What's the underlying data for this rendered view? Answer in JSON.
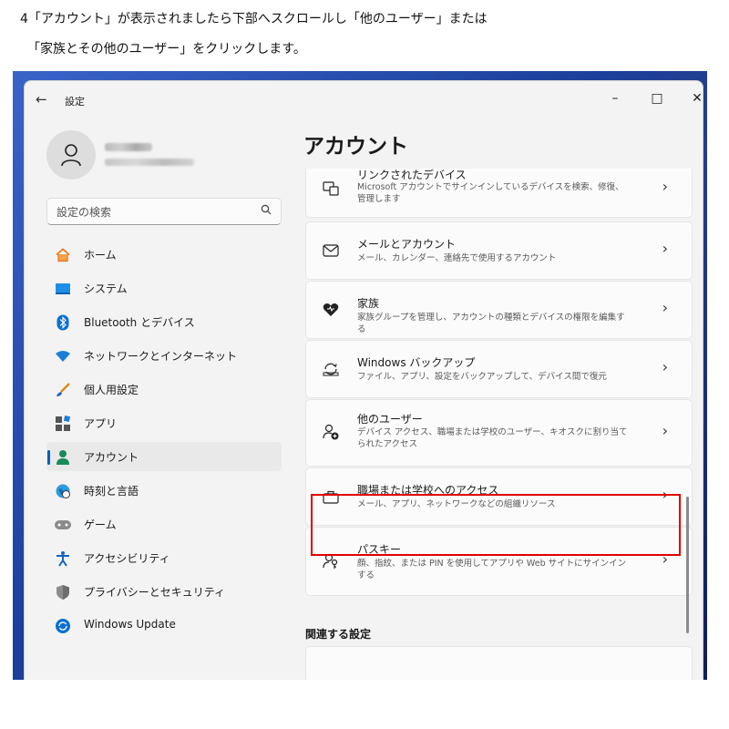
{
  "instructions": {
    "line1": "4「アカウント」が表示されましたら下部へスクロールし「他のユーザー」または",
    "line2": "「家族とその他のユーザー」をクリックします。"
  },
  "window": {
    "title": "設定",
    "back_icon": "arrow-left-icon",
    "controls": {
      "minimize": "–",
      "maximize": "□",
      "close": "✕"
    }
  },
  "search": {
    "placeholder": "設定の検索",
    "icon": "search-icon"
  },
  "sidebar": {
    "items": [
      {
        "label": "ホーム",
        "icon": "home-icon"
      },
      {
        "label": "システム",
        "icon": "monitor-icon"
      },
      {
        "label": "Bluetooth とデバイス",
        "icon": "bluetooth-icon"
      },
      {
        "label": "ネットワークとインターネット",
        "icon": "wifi-icon"
      },
      {
        "label": "個人用設定",
        "icon": "brush-icon"
      },
      {
        "label": "アプリ",
        "icon": "apps-icon"
      },
      {
        "label": "アカウント",
        "icon": "person-icon",
        "selected": true
      },
      {
        "label": "時刻と言語",
        "icon": "globe-clock-icon"
      },
      {
        "label": "ゲーム",
        "icon": "gamepad-icon"
      },
      {
        "label": "アクセシビリティ",
        "icon": "accessibility-icon"
      },
      {
        "label": "プライバシーとセキュリティ",
        "icon": "shield-icon"
      },
      {
        "label": "Windows Update",
        "icon": "update-icon"
      }
    ]
  },
  "main": {
    "title": "アカウント",
    "cards": [
      {
        "title": "リンクされたデバイス",
        "desc": "Microsoft アカウントでサインインしているデバイスを検索、修復、管理します",
        "icon": "linked-devices-icon"
      },
      {
        "title": "メールとアカウント",
        "desc": "メール、カレンダー、連絡先で使用するアカウント",
        "icon": "mail-icon"
      },
      {
        "title": "家族",
        "desc": "家族グループを管理し、アカウントの種類とデバイスの権限を編集する",
        "icon": "family-heart-icon"
      },
      {
        "title": "Windows バックアップ",
        "desc": "ファイル、アプリ、設定をバックアップして、デバイス間で復元",
        "icon": "backup-icon"
      },
      {
        "title": "他のユーザー",
        "desc": "デバイス アクセス、職場または学校のユーザー、キオスクに割り当てられたアクセス",
        "icon": "add-user-icon",
        "highlighted": true
      },
      {
        "title": "職場または学校へのアクセス",
        "desc": "メール、アプリ、ネットワークなどの組織リソース",
        "icon": "briefcase-icon"
      },
      {
        "title": "パスキー",
        "desc": "顔、指紋、または PIN を使用してアプリや Web サイトにサインインする",
        "icon": "passkey-icon"
      }
    ],
    "related_heading": "関連する設定",
    "chevron": "›"
  },
  "colors": {
    "accent": "#005fb8",
    "highlight_border": "#e00000"
  }
}
